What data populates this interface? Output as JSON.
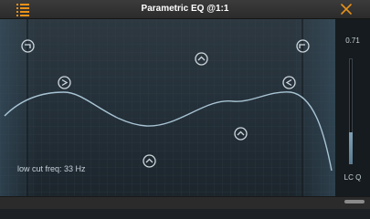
{
  "header": {
    "title": "Parametric EQ @1:1",
    "menu_icon": "list-icon",
    "close_icon": "close-icon"
  },
  "eq": {
    "readout": "low cut freq: 33 Hz",
    "curve_color": "#a8c4d4"
  },
  "side_panel": {
    "q_value": "0.71",
    "q_label": "LC Q",
    "q_level": 0.3
  },
  "colors": {
    "accent": "#e8921a",
    "handle": "#cfd8dd"
  }
}
